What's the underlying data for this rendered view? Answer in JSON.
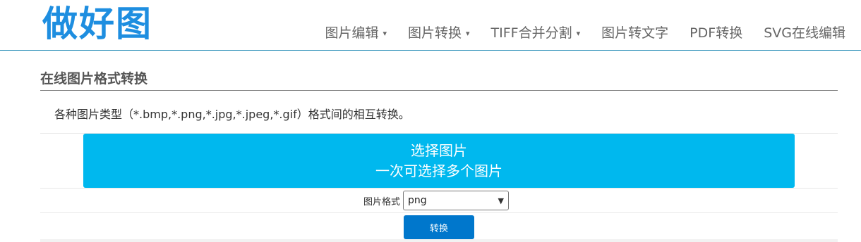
{
  "header": {
    "logo": "做好图",
    "nav": [
      {
        "label": "图片编辑",
        "dropdown": true
      },
      {
        "label": "图片转换",
        "dropdown": true
      },
      {
        "label": "TIFF合并分割",
        "dropdown": true
      },
      {
        "label": "图片转文字",
        "dropdown": false
      },
      {
        "label": "PDF转换",
        "dropdown": false
      },
      {
        "label": "SVG在线编辑",
        "dropdown": false
      }
    ]
  },
  "main": {
    "title": "在线图片格式转换",
    "description": "各种图片类型（*.bmp,*.png,*.jpg,*.jpeg,*.gif）格式间的相互转换。",
    "select_button": {
      "line1": "选择图片",
      "line2": "一次可选择多个图片"
    },
    "format": {
      "label": "图片格式",
      "selected": "png"
    },
    "convert_label": "转换"
  },
  "colors": {
    "accent": "#00b8ee",
    "logo": "#1e8ee0",
    "convert": "#0077cc",
    "header_rule": "#2a8fb8"
  }
}
